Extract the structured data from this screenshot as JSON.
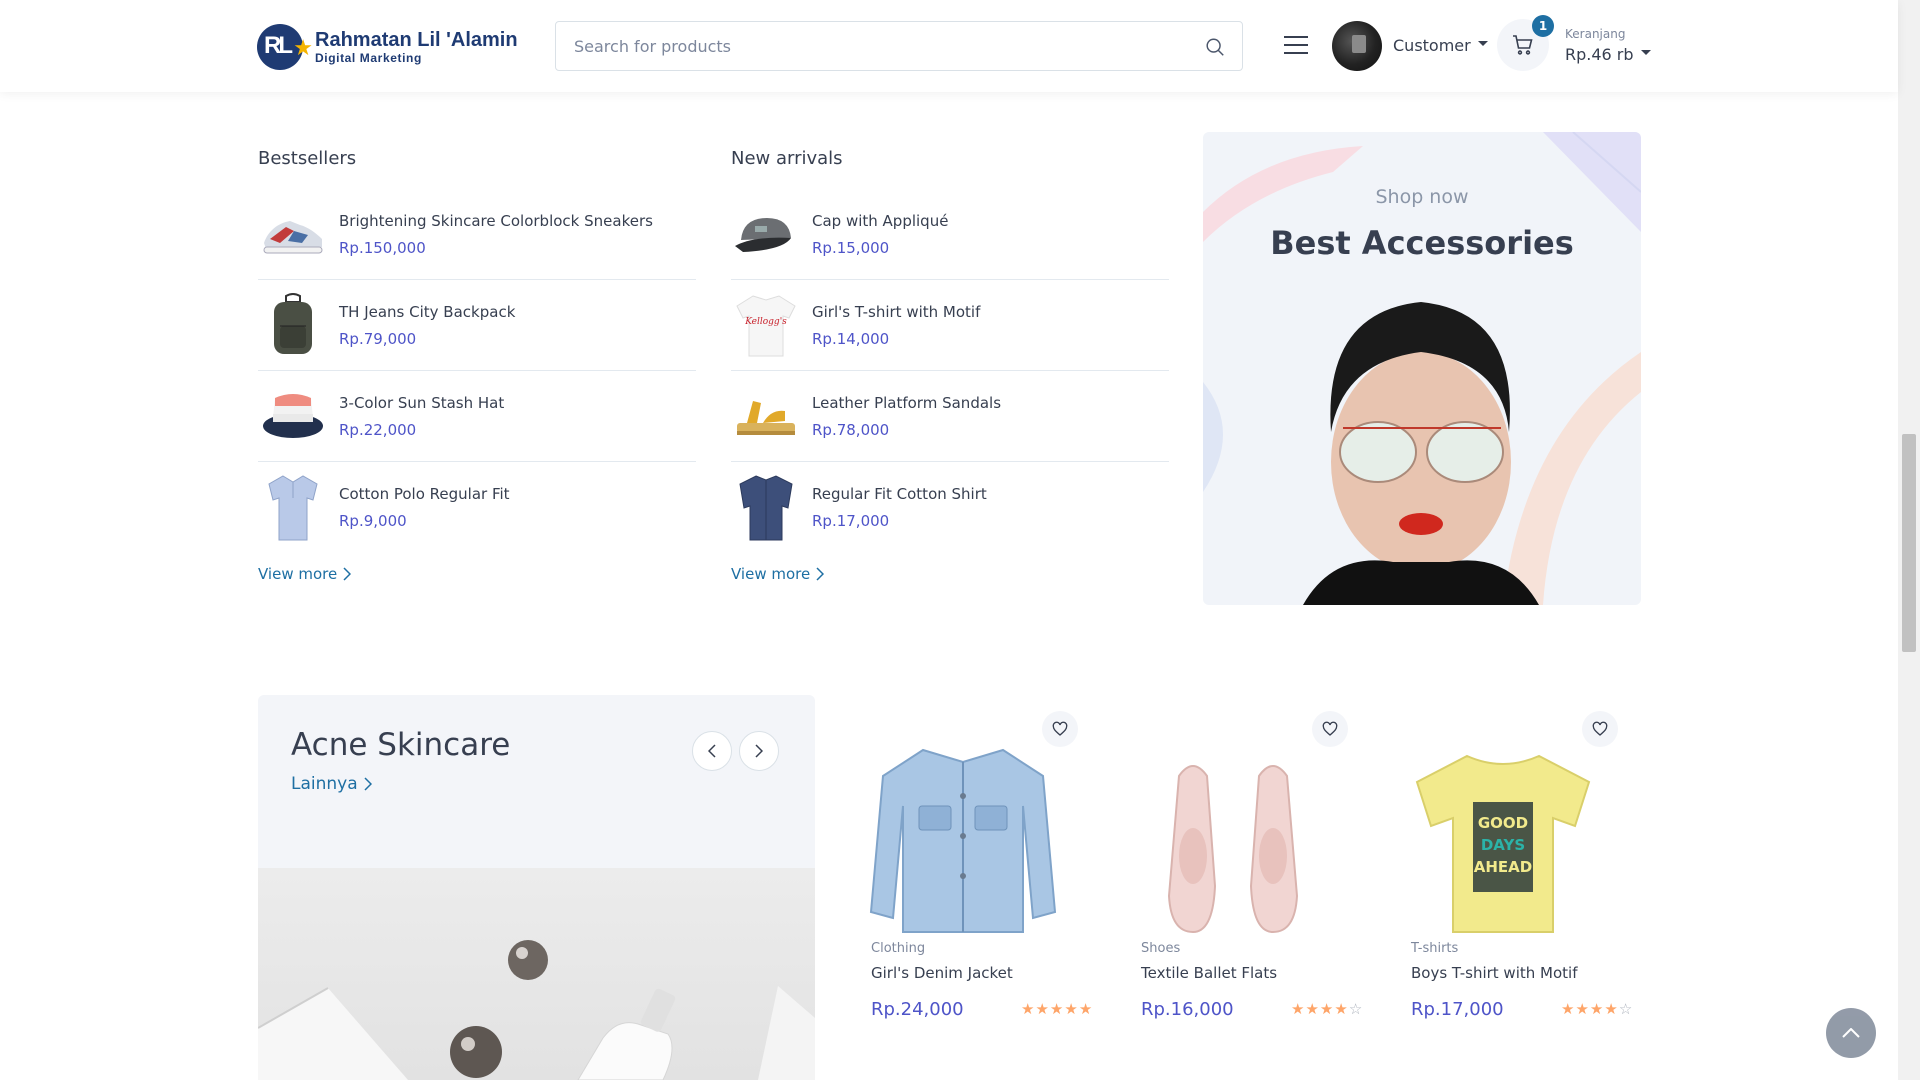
{
  "header": {
    "logo": {
      "name": "Rahmatan Lil 'Alamin",
      "tagline": "Digital Marketing"
    },
    "search_placeholder": "Search for products",
    "user_label": "Customer",
    "cart": {
      "badge": "1",
      "label": "Keranjang",
      "total": "Rp.46 rb"
    }
  },
  "bestsellers": {
    "title": "Bestsellers",
    "items": [
      {
        "name": "Brightening Skincare Colorblock Sneakers",
        "price": "Rp.150,000"
      },
      {
        "name": "TH Jeans City Backpack",
        "price": "Rp.79,000"
      },
      {
        "name": "3-Color Sun Stash Hat",
        "price": "Rp.22,000"
      },
      {
        "name": "Cotton Polo Regular Fit",
        "price": "Rp.9,000"
      }
    ],
    "view_more": "View more"
  },
  "new_arrivals": {
    "title": "New arrivals",
    "items": [
      {
        "name": "Cap with Appliqué",
        "price": "Rp.15,000"
      },
      {
        "name": "Girl's T-shirt with Motif",
        "price": "Rp.14,000"
      },
      {
        "name": "Leather Platform Sandals",
        "price": "Rp.78,000"
      },
      {
        "name": "Regular Fit Cotton Shirt",
        "price": "Rp.17,000"
      }
    ],
    "view_more": "View more"
  },
  "promo": {
    "subtitle": "Shop now",
    "title": "Best Accessories"
  },
  "category": {
    "title": "Acne Skincare",
    "link": "Lainnya"
  },
  "products": [
    {
      "category": "Clothing",
      "name": "Girl's Denim Jacket",
      "price": "Rp.24,000",
      "rating": 5
    },
    {
      "category": "Shoes",
      "name": "Textile Ballet Flats",
      "price": "Rp.16,000",
      "rating": 3.5
    },
    {
      "category": "T-shirts",
      "name": "Boys T-shirt with Motif",
      "price": "Rp.17,000",
      "rating": 4
    }
  ],
  "colors": {
    "accent": "#4e54c8",
    "link": "#1e6fa3",
    "star": "#fea569",
    "brand": "#1f3b73"
  }
}
